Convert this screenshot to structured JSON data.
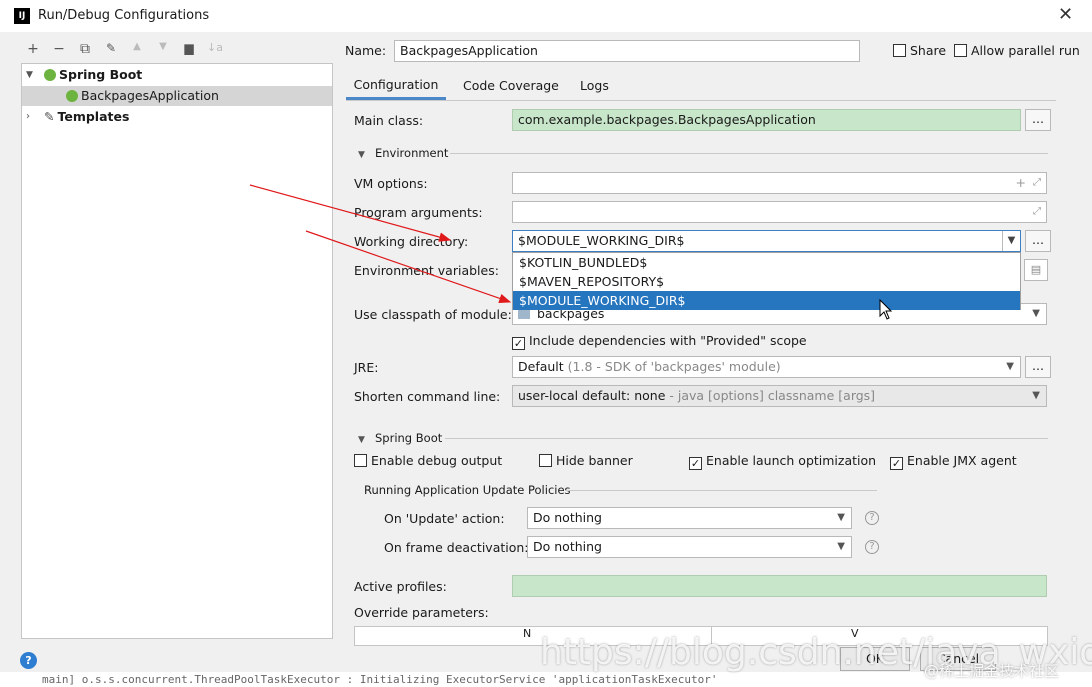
{
  "window": {
    "title": "Run/Debug Configurations",
    "icon": "IJ"
  },
  "toolbar": {
    "add": "+",
    "remove": "−",
    "copy": "⧉",
    "edit": "🔧",
    "up": "▲",
    "down": "▼",
    "folder": "📁",
    "sort": "↓a"
  },
  "tree": {
    "group": "Spring Boot",
    "child": "BackpagesApplication",
    "templates": "Templates"
  },
  "form": {
    "name_label": "Name:",
    "name_value": "BackpagesApplication",
    "share_label": "Share",
    "parallel_label": "Allow parallel run",
    "tabs": [
      "Configuration",
      "Code Coverage",
      "Logs"
    ],
    "main_class_label": "Main class:",
    "main_class_value": "com.example.backpages.BackpagesApplication",
    "environment_section": "Environment",
    "vm_options_label": "VM options:",
    "program_args_label": "Program arguments:",
    "working_dir_label": "Working directory:",
    "working_dir_value": "$MODULE_WORKING_DIR$",
    "env_vars_label": "Environment variables:",
    "classpath_label": "Use classpath of module:",
    "classpath_value": "backpages",
    "include_deps_label": "Include dependencies with \"Provided\" scope",
    "jre_label": "JRE:",
    "jre_value": "Default",
    "jre_hint": "(1.8 - SDK of 'backpages' module)",
    "shorten_label": "Shorten command line:",
    "shorten_value": "user-local default: none",
    "shorten_hint": " - java [options] classname [args]",
    "spring_section": "Spring Boot",
    "debug_output_label": "Enable debug output",
    "hide_banner_label": "Hide banner",
    "launch_opt_label": "Enable launch optimization",
    "jmx_label": "Enable JMX agent",
    "update_policies_label": "Running Application Update Policies",
    "on_update_label": "On 'Update' action:",
    "on_update_value": "Do nothing",
    "on_frame_label": "On frame deactivation:",
    "on_frame_value": "Do nothing",
    "active_profiles_label": "Active profiles:",
    "override_label": "Override parameters:",
    "col_name": "N",
    "col_value": "V"
  },
  "dropdown": {
    "items": [
      "$KOTLIN_BUNDLED$",
      "$MAVEN_REPOSITORY$",
      "$MODULE_WORKING_DIR$"
    ],
    "selected_index": 2
  },
  "buttons": {
    "ok": "OK",
    "cancel": "Cancel"
  },
  "watermark": "https://blog.csdn.net/java_wxid",
  "watermark2": "@稀土掘金技术社区",
  "console_line": "main] o.s.s.concurrent.ThreadPoolTaskExecutor  : Initializing ExecutorService 'applicationTaskExecutor'",
  "colors": {
    "accent": "#2675bf",
    "green_field": "#c8e6c9",
    "arrow": "#e0191b"
  },
  "icons": [
    "app-icon",
    "close-icon",
    "spring-leaf-icon",
    "wrench-icon",
    "help-icon",
    "expand-icon"
  ]
}
